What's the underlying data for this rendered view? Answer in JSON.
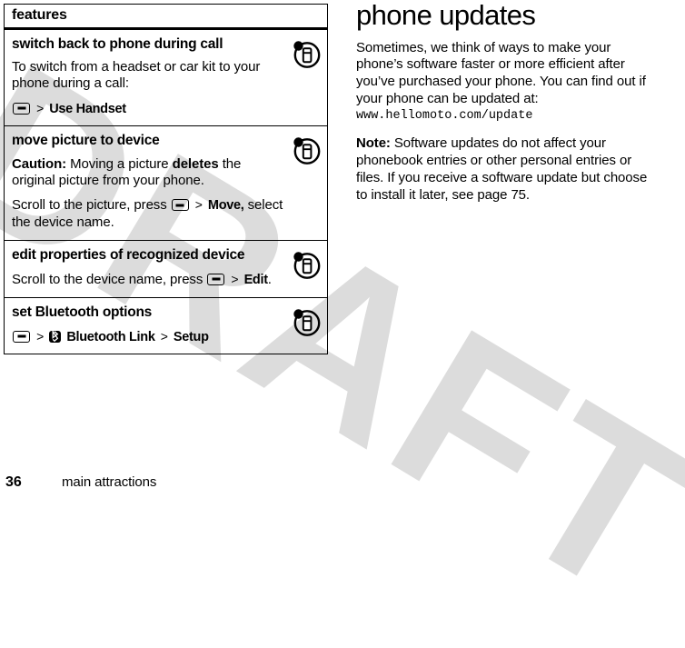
{
  "watermark": {
    "text": "DRAFT"
  },
  "features_table": {
    "header_label": "features",
    "rows": [
      {
        "title": "switch back to phone during call",
        "body": "To switch from a headset or car kit to your phone during a call:",
        "nav_label": "Use Handset",
        "icon": "bluetooth-device-icon"
      },
      {
        "title": "move picture to device",
        "caution_label": "Caution:",
        "caution_text_a": " Moving a picture ",
        "caution_bold": "deletes",
        "caution_text_b": " the original picture from your phone.",
        "instr_prefix": "Scroll to the picture, press",
        "instr_label": "Move,",
        "instr_suffix": "select the device name.",
        "icon": "bluetooth-device-icon"
      },
      {
        "title": "edit properties of recognized device",
        "instr_prefix": "Scroll to the device name, press",
        "instr_label": "Edit",
        "instr_suffix": ".",
        "icon": "bluetooth-device-icon"
      },
      {
        "title": "set Bluetooth options",
        "nav_label_1": "Bluetooth Link",
        "nav_label_2": "Setup",
        "icon": "bluetooth-device-icon"
      }
    ],
    "separator": ">"
  },
  "right_column": {
    "section_title": "phone updates",
    "paragraph_1": "Sometimes, we think of ways to make your phone’s software faster or more efficient after you’ve purchased your phone. You can find out if your phone can be updated at:",
    "url": "www.hellomoto.com/update",
    "note_label": "Note:",
    "note_text": " Software updates do not affect your phonebook entries or other personal entries or files. If you receive a software update but choose to install it later, see page 75."
  },
  "footer": {
    "page_number": "36",
    "title": "main attractions"
  },
  "colors": {
    "text": "#000000",
    "background": "#ffffff",
    "watermark": "#dcdcdc",
    "rule": "#000000"
  }
}
